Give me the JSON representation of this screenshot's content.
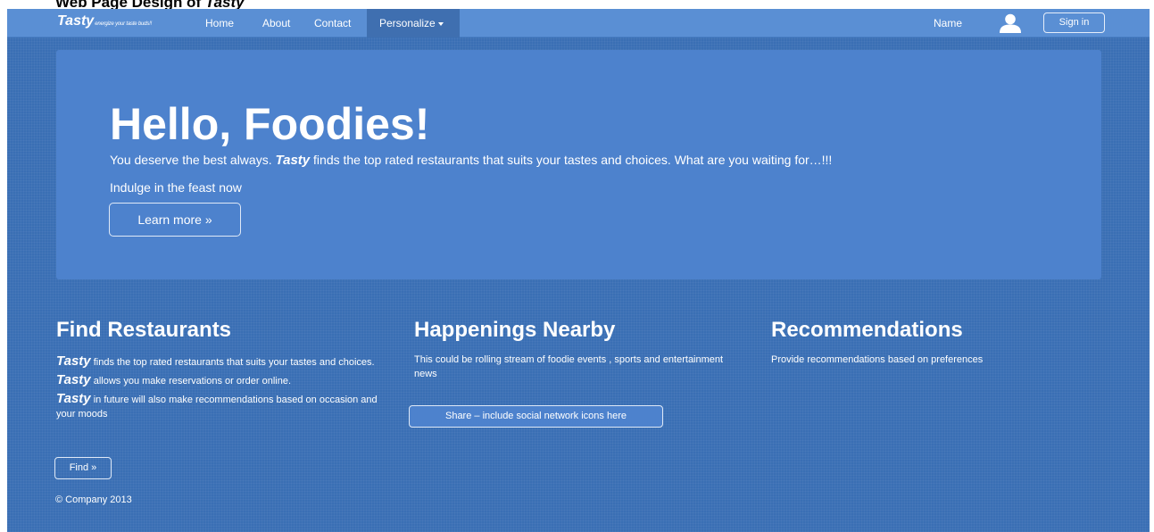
{
  "caption": {
    "prefix": "Web Page Design of",
    "brand": "Tasty"
  },
  "navbar": {
    "brand": "Tasty",
    "tagline": "energize your taste buds!!",
    "links": [
      "Home",
      "About",
      "Contact"
    ],
    "dropdown_label": "Personalize",
    "user_name": "Name",
    "signin_label": "Sign in"
  },
  "hero": {
    "title": "Hello, Foodies!",
    "line1_before": "You deserve the best always.",
    "line1_brand": "Tasty",
    "line1_after": "finds the top rated restaurants that suits your tastes and choices. What are you waiting for…!!!",
    "line2": "Indulge in the feast now",
    "button_label": "Learn more »"
  },
  "columns": {
    "find": {
      "title": "Find Restaurants",
      "p1_brand": "Tasty",
      "p1": "finds the top rated restaurants that suits your tastes and choices.",
      "p2_brand": "Tasty",
      "p2": "allows you make reservations or order online.",
      "p3_brand": "Tasty",
      "p3": "in future will also make recommendations based on occasion and your moods",
      "button_label": "Find »"
    },
    "happenings": {
      "title": "Happenings Nearby",
      "text": "This could be rolling stream of foodie events , sports and entertainment news",
      "button_label": "Share – include social network icons here"
    },
    "recommendations": {
      "title": "Recommendations",
      "text": "Provide recommendations based on preferences"
    }
  },
  "footer": {
    "text": "© Company 2013"
  },
  "colors": {
    "page_bg": "#3a6fb4",
    "navbar_bg": "#5a8fd4",
    "hero_bg": "#4d82cd",
    "text": "#ffffff"
  }
}
